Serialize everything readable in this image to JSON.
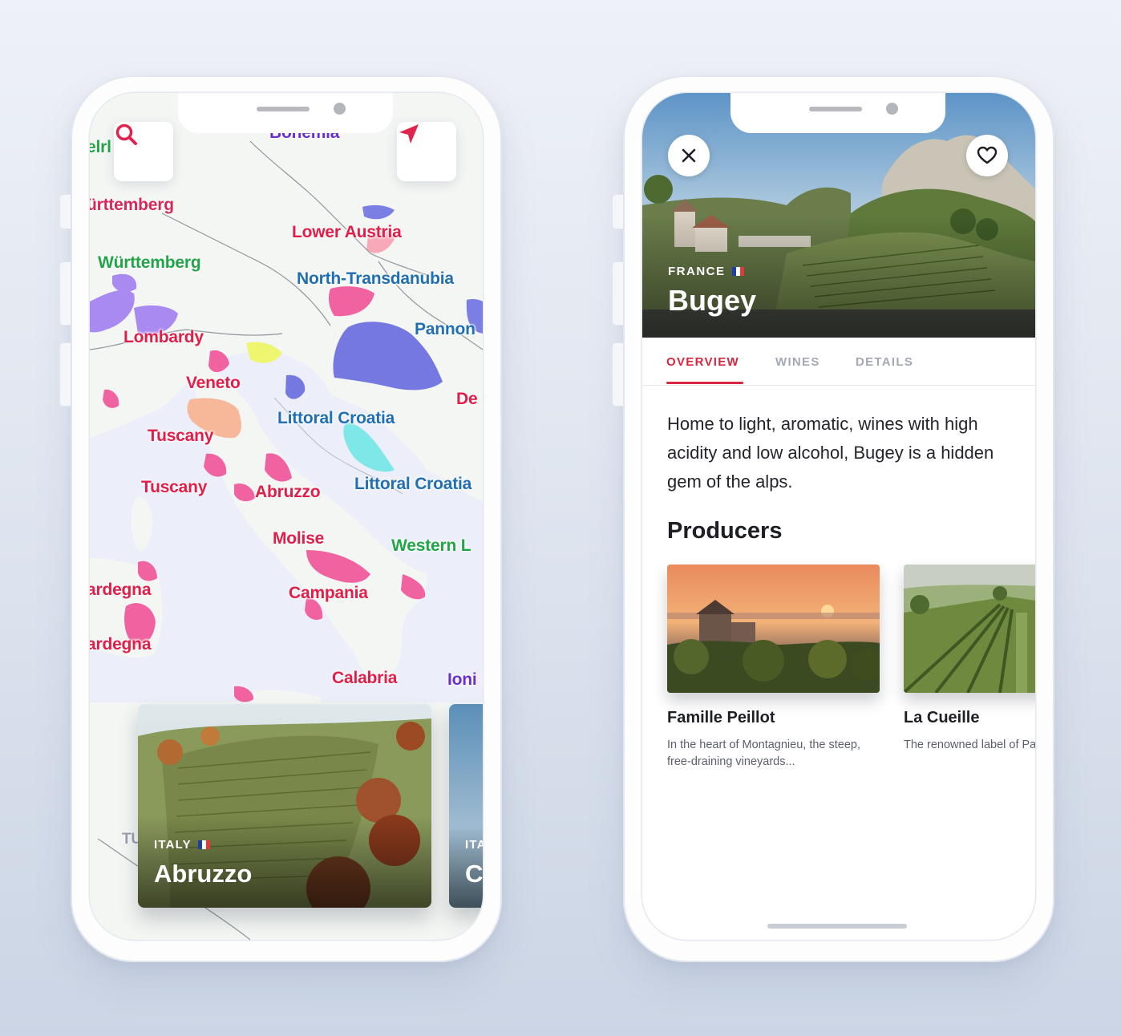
{
  "map_screen": {
    "labels": [
      {
        "text": "Bohemia",
        "color": "#6a2fd1"
      },
      {
        "text": "elrl",
        "color": "#22a545"
      },
      {
        "text": "ürttemberg",
        "color": "#d7285a"
      },
      {
        "text": "Lower Austria",
        "color": "#e11d48"
      },
      {
        "text": "Württemberg",
        "color": "#21a547"
      },
      {
        "text": "North-Transdanubia",
        "color": "#1f6fb2"
      },
      {
        "text": "Pannon",
        "color": "#1f6fb2"
      },
      {
        "text": "Lombardy",
        "color": "#e11d48"
      },
      {
        "text": "Veneto",
        "color": "#e11d48"
      },
      {
        "text": "De",
        "color": "#e11d48"
      },
      {
        "text": "Littoral Croatia",
        "color": "#1f6fb2"
      },
      {
        "text": "Tuscany",
        "color": "#e11d48"
      },
      {
        "text": "Tuscany",
        "color": "#e11d48"
      },
      {
        "text": "Abruzzo",
        "color": "#e11d48"
      },
      {
        "text": "Littoral Croatia",
        "color": "#1f6fb2"
      },
      {
        "text": "Molise",
        "color": "#e11d48"
      },
      {
        "text": "Western L",
        "color": "#21a547"
      },
      {
        "text": "ardegna",
        "color": "#e11d48"
      },
      {
        "text": "Campania",
        "color": "#e11d48"
      },
      {
        "text": "ardegna",
        "color": "#e11d48"
      },
      {
        "text": "Calabria",
        "color": "#e11d48"
      },
      {
        "text": "Ioni",
        "color": "#6a2fd1"
      },
      {
        "text": "TU",
        "color": "#9aa0ab"
      }
    ],
    "search_icon": "search-icon",
    "locate_icon": "navigation-arrow-icon",
    "cards": [
      {
        "country": "ITALY",
        "name": "Abruzzo"
      },
      {
        "country": "ITA",
        "name": "C"
      }
    ]
  },
  "detail_screen": {
    "country": "FRANCE",
    "region": "Bugey",
    "close_icon": "close-icon",
    "favorite_icon": "heart-icon",
    "tabs": [
      {
        "label": "OVERVIEW",
        "active": true
      },
      {
        "label": "WINES",
        "active": false
      },
      {
        "label": "DETAILS",
        "active": false
      }
    ],
    "description": "Home to light, aromatic, wines with high acidity and low alcohol, Bugey is a hidden gem of the alps.",
    "producers_title": "Producers",
    "producers": [
      {
        "name": "Famille Peillot",
        "description": "In the heart of Montagnieu, the steep, free-draining vineyards..."
      },
      {
        "name": "La Cueille",
        "description": "The renowned label of Patrick Bottex."
      }
    ]
  },
  "colors": {
    "accent": "#d7263d",
    "inactive_tab": "#a3a8b3"
  }
}
